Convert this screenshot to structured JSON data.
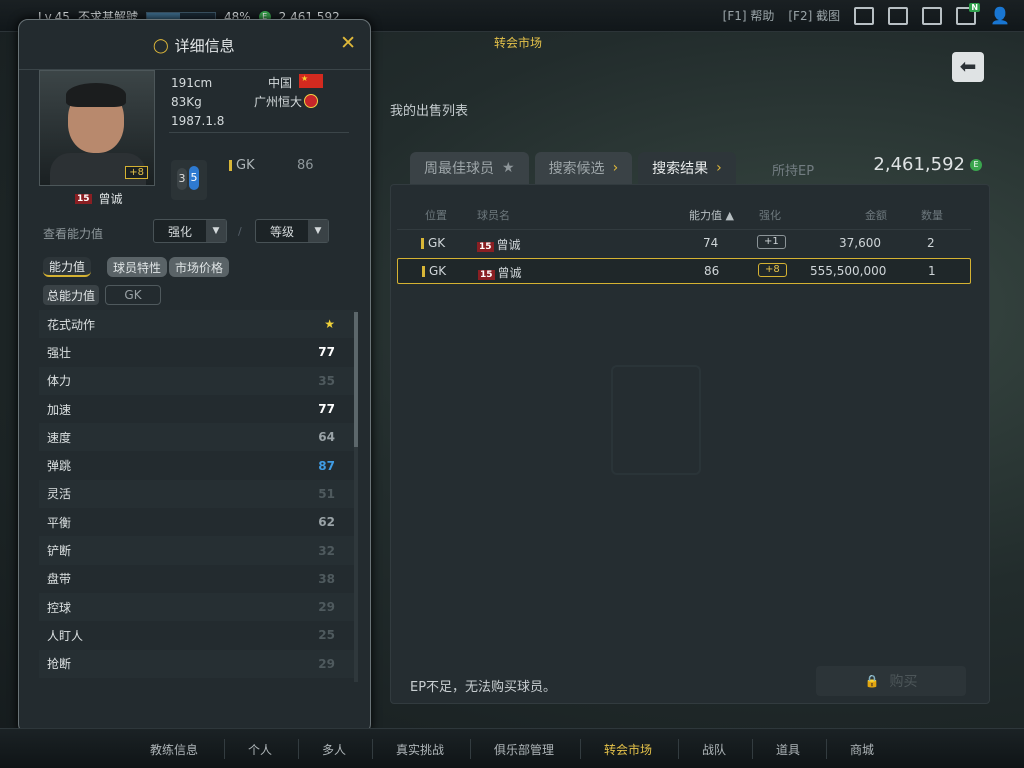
{
  "topbar": {
    "level": "Lv.45",
    "club_name": "不求甚解號",
    "exp_percent": "48%",
    "exp_fraction": 0.48,
    "coins": "2,461,592",
    "help": "[F1] 帮助",
    "screenshot": "[F2] 截图",
    "icons": [
      "mail-icon",
      "roster-icon",
      "calendar-check-icon",
      "chat-notice-icon",
      "profile-icon"
    ],
    "notice_badge": "N"
  },
  "market": {
    "title": "转会市场",
    "my_sell_list": "我的出售列表",
    "tabs": [
      {
        "label": "周最佳球员"
      },
      {
        "label": "搜索候选"
      },
      {
        "label": "搜索结果"
      }
    ],
    "ep_label": "所持EP",
    "ep_value": "2,461,592",
    "ep_badge": "E",
    "columns": {
      "pos": "位置",
      "name": "球员名",
      "ovr": "能力值 ▲",
      "enh": "强化",
      "price": "金额",
      "qty": "数量"
    },
    "rows": [
      {
        "pos": "GK",
        "num": "15",
        "name": "曾诚",
        "ovr": "74",
        "enh": "+1",
        "price": "37,600",
        "qty": "2"
      },
      {
        "pos": "GK",
        "num": "15",
        "name": "曾诚",
        "ovr": "86",
        "enh": "+8",
        "price": "555,500,000",
        "qty": "1"
      }
    ],
    "warning": "EP不足，无法购买球员。",
    "buy_label": "购买"
  },
  "detail": {
    "title": "详细信息",
    "close": "✕",
    "player": {
      "height": "191cm",
      "weight": "83Kg",
      "birth": "1987.1.8",
      "nation": "中国",
      "club": "广州恒大",
      "number": "15",
      "name": "曾诚",
      "enh_badge": "+8",
      "left_foot": "3",
      "right_foot": "5",
      "position": "GK",
      "ovr": "86"
    },
    "view_label": "查看能力值",
    "dd_enhance": "强化",
    "dd_grade": "等级",
    "dd_sep": "/",
    "subtabs": [
      "能力值",
      "球员特性",
      "市场价格"
    ],
    "pill_total": "总能力值",
    "pill_pos": "GK",
    "stats": [
      {
        "name": "花式动作",
        "value": "★",
        "color": "#f0d23a"
      },
      {
        "name": "强壮",
        "value": "77",
        "color": "#ffffff"
      },
      {
        "name": "体力",
        "value": "35",
        "color": "#4f5a5e"
      },
      {
        "name": "加速",
        "value": "77",
        "color": "#ffffff"
      },
      {
        "name": "速度",
        "value": "64",
        "color": "#9aa3a7"
      },
      {
        "name": "弹跳",
        "value": "87",
        "color": "#3f9be3"
      },
      {
        "name": "灵活",
        "value": "51",
        "color": "#4f5a5e"
      },
      {
        "name": "平衡",
        "value": "62",
        "color": "#9aa3a7"
      },
      {
        "name": "铲断",
        "value": "32",
        "color": "#4f5a5e"
      },
      {
        "name": "盘带",
        "value": "38",
        "color": "#4f5a5e"
      },
      {
        "name": "控球",
        "value": "29",
        "color": "#4f5a5e"
      },
      {
        "name": "人盯人",
        "value": "25",
        "color": "#4f5a5e"
      },
      {
        "name": "抢断",
        "value": "29",
        "color": "#4f5a5e"
      }
    ]
  },
  "nav": {
    "items": [
      "教练信息",
      "个人",
      "多人",
      "真实挑战",
      "俱乐部管理",
      "转会市场",
      "战队",
      "道具",
      "商城"
    ],
    "active": "转会市场"
  }
}
